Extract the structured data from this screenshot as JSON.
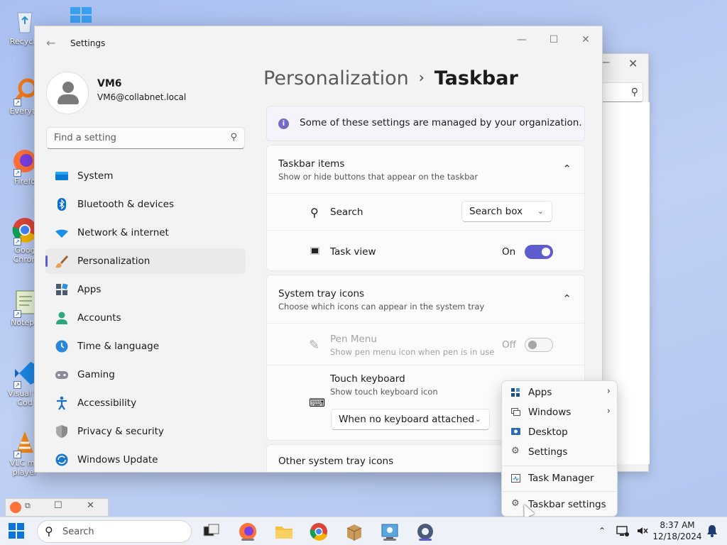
{
  "desktop": {
    "icons": [
      {
        "label": "Recycle",
        "icon": "recycle-bin-icon"
      },
      {
        "label": "Everyth",
        "icon": "everything-icon"
      },
      {
        "label": "Firefo",
        "icon": "firefox-icon"
      },
      {
        "label": "Goog Chron",
        "icon": "chrome-icon"
      },
      {
        "label": "Notepa",
        "icon": "notepad-icon"
      },
      {
        "label": "Visual St Cod",
        "icon": "vscode-icon"
      },
      {
        "label": "VLC me player",
        "icon": "vlc-icon"
      }
    ]
  },
  "window": {
    "title": "Settings",
    "minimize": "—",
    "maximize": "☐",
    "close": "✕"
  },
  "profile": {
    "name": "VM6",
    "email": "VM6@collabnet.local"
  },
  "search": {
    "placeholder": "Find a setting"
  },
  "nav": [
    {
      "label": "System",
      "icon": "system-icon",
      "color": "#0078d4"
    },
    {
      "label": "Bluetooth & devices",
      "icon": "bluetooth-icon",
      "color": "#0a6ed1"
    },
    {
      "label": "Network & internet",
      "icon": "wifi-icon",
      "color": "#1a8fe8"
    },
    {
      "label": "Personalization",
      "icon": "brush-icon",
      "color": "#d98a3c",
      "selected": true
    },
    {
      "label": "Apps",
      "icon": "apps-icon",
      "color": "#5a6a80"
    },
    {
      "label": "Accounts",
      "icon": "accounts-icon",
      "color": "#2aa87b"
    },
    {
      "label": "Time & language",
      "icon": "globe-clock-icon",
      "color": "#2b88d8"
    },
    {
      "label": "Gaming",
      "icon": "gaming-icon",
      "color": "#7a7a8a"
    },
    {
      "label": "Accessibility",
      "icon": "accessibility-icon",
      "color": "#1a6fc8"
    },
    {
      "label": "Privacy & security",
      "icon": "shield-icon",
      "color": "#7a7a7a"
    },
    {
      "label": "Windows Update",
      "icon": "update-icon",
      "color": "#1a78d0"
    }
  ],
  "breadcrumb": {
    "parent": "Personalization",
    "sep": "›",
    "current": "Taskbar"
  },
  "info": {
    "text": "Some of these settings are managed by your organization."
  },
  "taskbar_items": {
    "title": "Taskbar items",
    "subtitle": "Show or hide buttons that appear on the taskbar",
    "search_label": "Search",
    "search_value": "Search box",
    "taskview_label": "Task view",
    "taskview_state": "On"
  },
  "tray_icons": {
    "title": "System tray icons",
    "subtitle": "Choose which icons can appear in the system tray",
    "pen_label": "Pen Menu",
    "pen_sub": "Show pen menu icon when pen is in use",
    "pen_state": "Off",
    "touch_label": "Touch keyboard",
    "touch_sub": "Show touch keyboard icon",
    "touch_value": "When no keyboard attached"
  },
  "other_tray": {
    "title": "Other system tray icons"
  },
  "context_menu": {
    "items": [
      {
        "label": "Apps",
        "icon": "apps-grid-icon",
        "submenu": true
      },
      {
        "label": "Windows",
        "icon": "windows-stack-icon",
        "submenu": true
      },
      {
        "label": "Desktop",
        "icon": "desktop-icon",
        "submenu": false
      },
      {
        "label": "Settings",
        "icon": "gear-icon",
        "submenu": false
      },
      {
        "label": "Task Manager",
        "icon": "task-manager-icon",
        "submenu": false
      },
      {
        "label": "Taskbar settings",
        "icon": "gear-icon",
        "submenu": false
      }
    ]
  },
  "taskbar": {
    "search_placeholder": "Search",
    "time": "8:37 AM",
    "date": "12/18/2024"
  },
  "colors": {
    "accent": "#5e5ccf",
    "desktop": "#b4c8f0"
  }
}
